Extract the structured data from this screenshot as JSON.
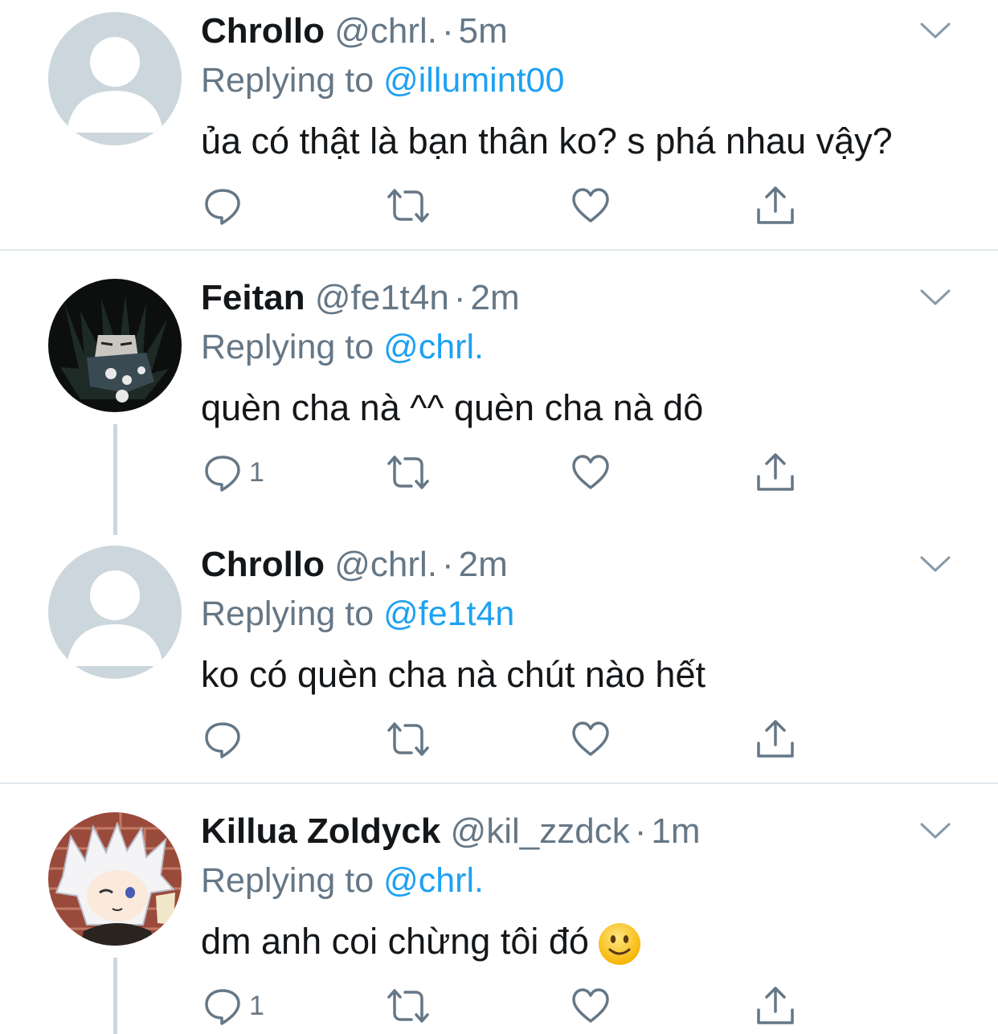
{
  "tweets": [
    {
      "name": "Chrollo",
      "handle": "@chrl.",
      "separator": "·",
      "time": "5m",
      "replying_label": "Replying to",
      "replying_to": "@illumint00",
      "text": "ủa có thật là bạn thân ko? s phá nhau vậy?",
      "reply_count": "",
      "avatar": "default-avatar-icon"
    },
    {
      "name": "Feitan",
      "handle": "@fe1t4n",
      "separator": "·",
      "time": "2m",
      "replying_label": "Replying to",
      "replying_to": "@chrl.",
      "text": "quèn cha nà ^^ quèn cha nà dô",
      "reply_count": "1",
      "avatar": "anime-character-avatar"
    },
    {
      "name": "Chrollo",
      "handle": "@chrl.",
      "separator": "·",
      "time": "2m",
      "replying_label": "Replying to",
      "replying_to": "@fe1t4n",
      "text": "ko có quèn cha nà chút nào hết",
      "reply_count": "",
      "avatar": "default-avatar-icon"
    },
    {
      "name": "Killua Zoldyck",
      "handle": "@kil_zzdck",
      "separator": "·",
      "time": "1m",
      "replying_label": "Replying to",
      "replying_to": "@chrl.",
      "text": "dm anh coi chừng tôi đó",
      "reply_count": "1",
      "avatar": "anime-character-avatar",
      "emoji": "slightly-smiling-face-icon"
    }
  ],
  "colors": {
    "name": "#14171a",
    "muted": "#657786",
    "mention": "#1da1f2",
    "divider": "#e1e8ed",
    "thread_line": "#ccd6dd"
  }
}
